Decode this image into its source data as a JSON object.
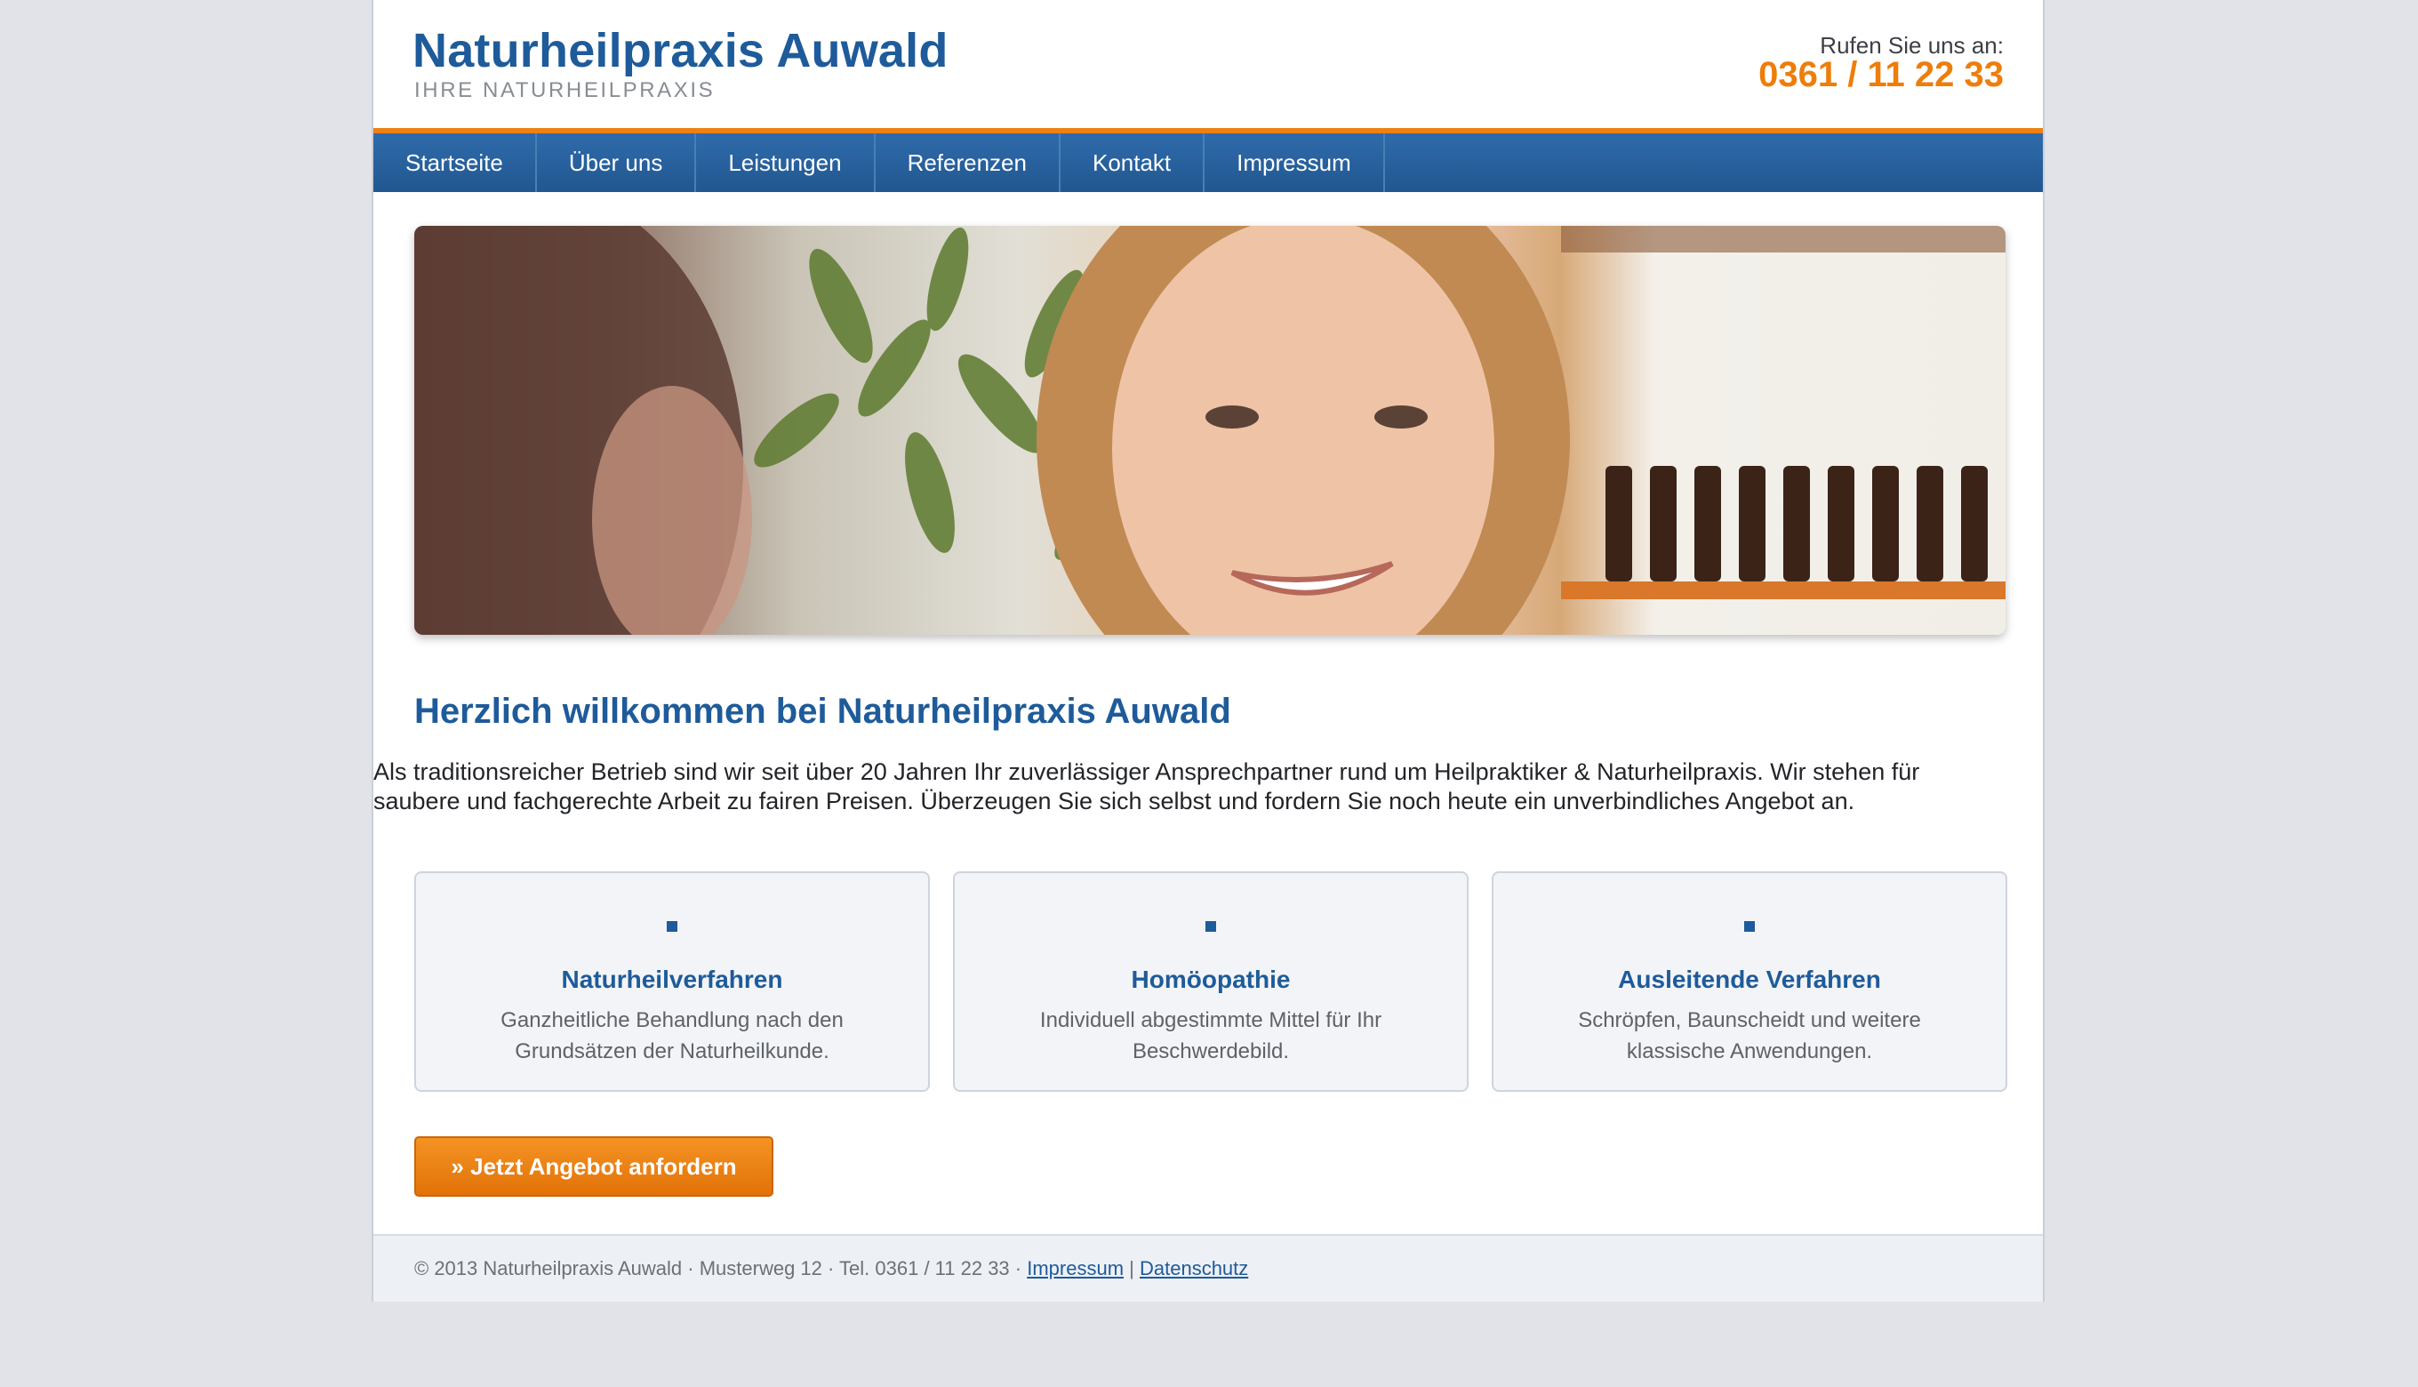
{
  "header": {
    "title": "Naturheilpraxis Auwald",
    "tagline": "IHRE NATURHEILPRAXIS",
    "call_label": "Rufen Sie uns an:",
    "phone": "0361 / 11 22 33"
  },
  "nav": {
    "items": [
      {
        "label": "Startseite"
      },
      {
        "label": "Über uns"
      },
      {
        "label": "Leistungen"
      },
      {
        "label": "Referenzen"
      },
      {
        "label": "Kontakt"
      },
      {
        "label": "Impressum"
      }
    ]
  },
  "main": {
    "welcome_title": "Herzlich willkommen bei Naturheilpraxis Auwald",
    "intro": "Als traditionsreicher Betrieb sind wir seit über 20 Jahren Ihr zuverlässiger Ansprechpartner rund um Heilpraktiker & Naturheilpraxis. Wir stehen für saubere und fachgerechte Arbeit zu fairen Preisen. Überzeugen Sie sich selbst und fordern Sie noch heute ein unverbindliches Angebot an.",
    "cards": [
      {
        "title": "Naturheilverfahren",
        "description": "Ganzheitliche Behandlung nach den Grundsätzen der Naturheilkunde."
      },
      {
        "title": "Homöopathie",
        "description": "Individuell abgestimmte Mittel für Ihr Beschwerdebild."
      },
      {
        "title": "Ausleitende Verfahren",
        "description": "Schröpfen, Baunscheidt und weitere klassische Anwendungen."
      }
    ],
    "cta_label": "» Jetzt Angebot anfordern"
  },
  "footer": {
    "text": "© 2013 Naturheilpraxis Auwald · Musterweg 12 · Tel. 0361 / 11 22 33 · ",
    "impressum_link": "Impressum",
    "separator": "|",
    "datenschutz_link": "Datenschutz"
  },
  "colors": {
    "brand_blue": "#1e5b9a",
    "accent_orange": "#ee7d0a",
    "page_background": "#e1e3e8"
  }
}
